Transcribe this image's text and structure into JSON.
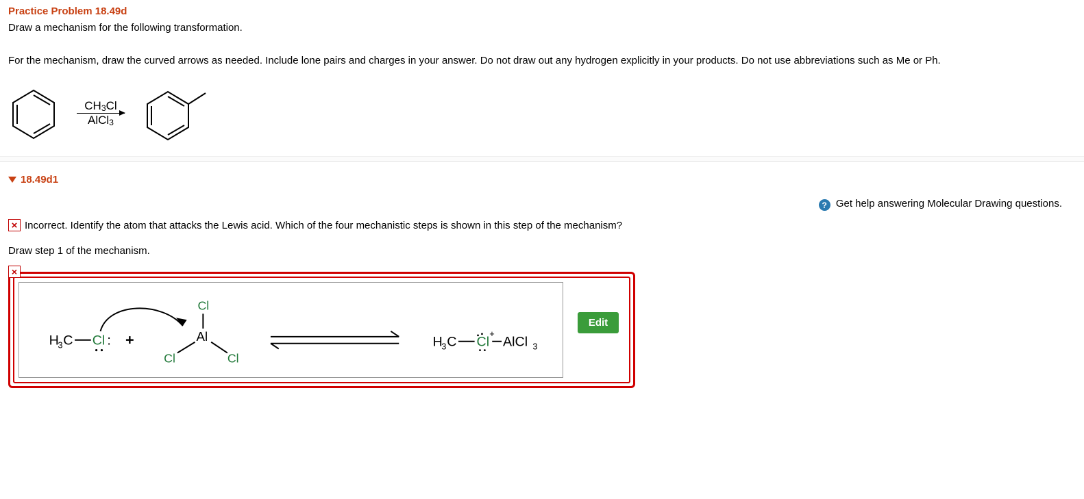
{
  "title": "Practice Problem 18.49d",
  "instruction": "Draw a mechanism for the following transformation.",
  "detail": "For the mechanism, draw the curved arrows as needed. Include lone pairs and charges in your answer. Do not draw out any hydrogen explicitly in your products. Do not use abbreviations such as Me or Ph.",
  "reaction": {
    "reagent_top": "CH3Cl",
    "reagent_bottom": "AlCl3",
    "starting_material": "benzene",
    "product": "toluene"
  },
  "part": {
    "label": "18.49d1",
    "help_text": "Get help answering Molecular Drawing questions.",
    "help_icon": "?",
    "feedback": "Incorrect. Identify the atom that attacks the Lewis acid. Which of the four mechanistic steps is shown in this step of the mechanism?",
    "step_label": "Draw step 1 of the mechanism.",
    "edit_label": "Edit",
    "x_glyph": "×",
    "drawing": {
      "left_species": "H3C—Cl:",
      "plus": "+",
      "center_species": "AlCl3 (Cl–Al(–Cl)(–Cl))",
      "arrow": "equilibrium",
      "right_species": "H3C—Cl+–AlCl3 (with lone pairs on Cl)",
      "curved_arrow": "from Cl lone pair of CH3Cl to Al"
    }
  }
}
